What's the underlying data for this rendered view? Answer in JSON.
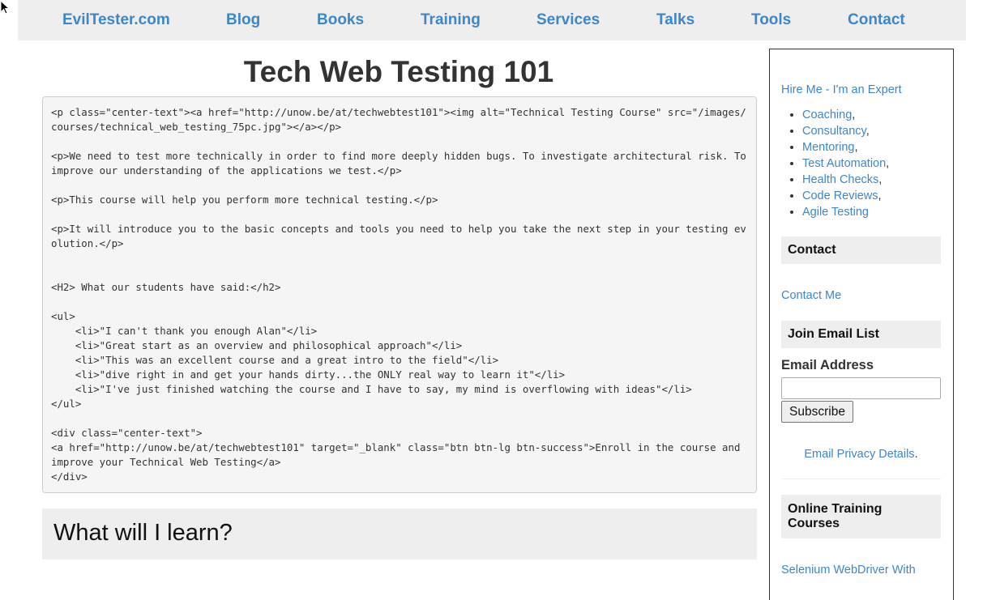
{
  "nav": {
    "items": [
      {
        "label": "EvilTester.com"
      },
      {
        "label": "Blog"
      },
      {
        "label": "Books"
      },
      {
        "label": "Training"
      },
      {
        "label": "Services"
      },
      {
        "label": "Talks"
      },
      {
        "label": "Tools"
      },
      {
        "label": "Contact"
      }
    ]
  },
  "main": {
    "title": "Tech Web Testing 101",
    "code": "<p class=\"center-text\"><a href=\"http://unow.be/at/techwebtest101\"><img alt=\"Technical Testing Course\" src=\"/images/courses/technical_web_testing_75pc.jpg\"></a></p>\n\n<p>We need to test more technically in order to find more deeply hidden bugs. To investigate architectural risk. To improve our understanding of the applications we test.</p>\n\n<p>This course will help you perform more technical testing.</p>\n\n<p>It will introduce you to the basic concepts and tools you need to help you take the next step in your testing evolution.</p>\n\n\n<H2> What our students have said:</h2>\n\n<ul>\n    <li>\"I can't thank you enough Alan\"</li>\n    <li>\"Great start as an overview and philosophical approach\"</li>\n    <li>\"This was an excellent course and a great intro to the field\"</li>\n    <li>\"dive right in and get your hands dirty...the ONLY real way to learn it\"</li>\n    <li>\"I've just finished watching the course and I have to say, my mind is overflowing with ideas\"</li>\n</ul>\n\n<div class=\"center-text\">\n<a href=\"http://unow.be/at/techwebtest101\" target=\"_blank\" class=\"btn btn-lg btn-success\">Enroll in the course and improve your Technical Web Testing</a>\n</div>",
    "learn_heading": "What will I learn?"
  },
  "sidebar": {
    "hire_link": "Hire Me - I'm an Expert",
    "services": [
      {
        "label": "Coaching",
        "suffix": ","
      },
      {
        "label": "Consultancy",
        "suffix": ","
      },
      {
        "label": "Mentoring",
        "suffix": ","
      },
      {
        "label": "Test Automation",
        "suffix": ","
      },
      {
        "label": "Health Checks",
        "suffix": ","
      },
      {
        "label": "Code Reviews",
        "suffix": ","
      },
      {
        "label": "Agile Testing",
        "suffix": ""
      }
    ],
    "contact_heading": "Contact",
    "contact_link": "Contact Me",
    "email_heading": "Join Email List",
    "email_label": "Email Address",
    "email_value": "",
    "subscribe_label": "Subscribe",
    "privacy_link": "Email Privacy Details",
    "privacy_suffix": ".",
    "courses_heading": "Online Training Courses",
    "course_link": "Selenium WebDriver With"
  },
  "colors": {
    "link": "#3d87c8",
    "nav_background": "#eeeeee",
    "code_background": "#f5f5f5"
  }
}
